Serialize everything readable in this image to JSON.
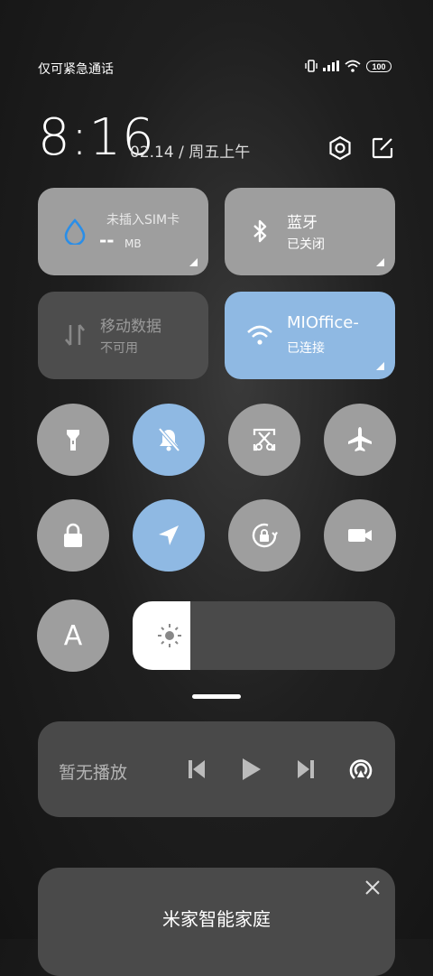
{
  "status_bar": {
    "carrier_text": "仅可紧急通话",
    "battery_level": "100"
  },
  "clock": {
    "time": "8:16",
    "date": "02.14 / 周五上午"
  },
  "tiles": {
    "data_usage": {
      "title": "未插入SIM卡",
      "value": "--",
      "unit": "MB"
    },
    "bluetooth": {
      "title": "蓝牙",
      "status": "已关闭"
    },
    "mobile_data": {
      "title": "移动数据",
      "status": "不可用"
    },
    "wifi": {
      "title": "MIOffice-",
      "status": "已连接"
    }
  },
  "toggles": [
    {
      "name": "flashlight",
      "active": false
    },
    {
      "name": "mute",
      "active": true
    },
    {
      "name": "screenshot",
      "active": false
    },
    {
      "name": "airplane-mode",
      "active": false
    },
    {
      "name": "lock-screen",
      "active": false
    },
    {
      "name": "location",
      "active": true
    },
    {
      "name": "auto-rotate",
      "active": false
    },
    {
      "name": "screen-recorder",
      "active": false
    }
  ],
  "brightness": {
    "auto_label": "A",
    "level_percent": 15
  },
  "media": {
    "status": "暂无播放"
  },
  "smart_home": {
    "title": "米家智能家庭"
  },
  "colors": {
    "tile_gray": "#9e9e9e",
    "tile_active_blue": "#8fb9e3",
    "tile_unavailable": "#4d4d4d"
  }
}
